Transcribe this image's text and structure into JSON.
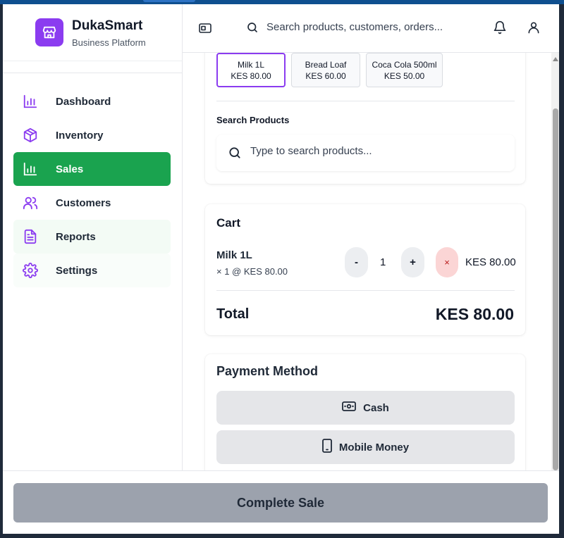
{
  "brand": {
    "name": "DukaSmart",
    "subtitle": "Business Platform"
  },
  "sidebar": {
    "items": [
      {
        "label": "Dashboard",
        "icon": "bar-chart-icon"
      },
      {
        "label": "Inventory",
        "icon": "box-icon"
      },
      {
        "label": "Sales",
        "icon": "bar-chart-icon",
        "active": true
      },
      {
        "label": "Customers",
        "icon": "users-icon"
      },
      {
        "label": "Reports",
        "icon": "document-icon"
      },
      {
        "label": "Settings",
        "icon": "gear-icon"
      }
    ]
  },
  "header": {
    "search_placeholder": "Search products, customers, orders..."
  },
  "products": {
    "chips": [
      {
        "name": "Milk 1L",
        "price": "KES 80.00",
        "selected": true
      },
      {
        "name": "Bread Loaf",
        "price": "KES 60.00"
      },
      {
        "name": "Coca Cola 500ml",
        "price": "KES 50.00"
      }
    ],
    "search_label": "Search Products",
    "search_placeholder": "Type to search products..."
  },
  "cart": {
    "title": "Cart",
    "items": [
      {
        "name": "Milk 1L",
        "detail": "× 1 @ KES 80.00",
        "qty": "1",
        "line_total": "KES 80.00"
      }
    ],
    "minus": "-",
    "plus": "+",
    "remove": "×",
    "total_label": "Total",
    "total_value": "KES 80.00"
  },
  "payment": {
    "title": "Payment Method",
    "cash_label": "Cash",
    "mobile_label": "Mobile Money"
  },
  "footer": {
    "complete_label": "Complete Sale"
  },
  "colors": {
    "accent": "#8b3cf0",
    "active_green": "#1aa34f",
    "complete_disabled": "#9ca2ad",
    "remove_bg": "#fbd5d5"
  }
}
